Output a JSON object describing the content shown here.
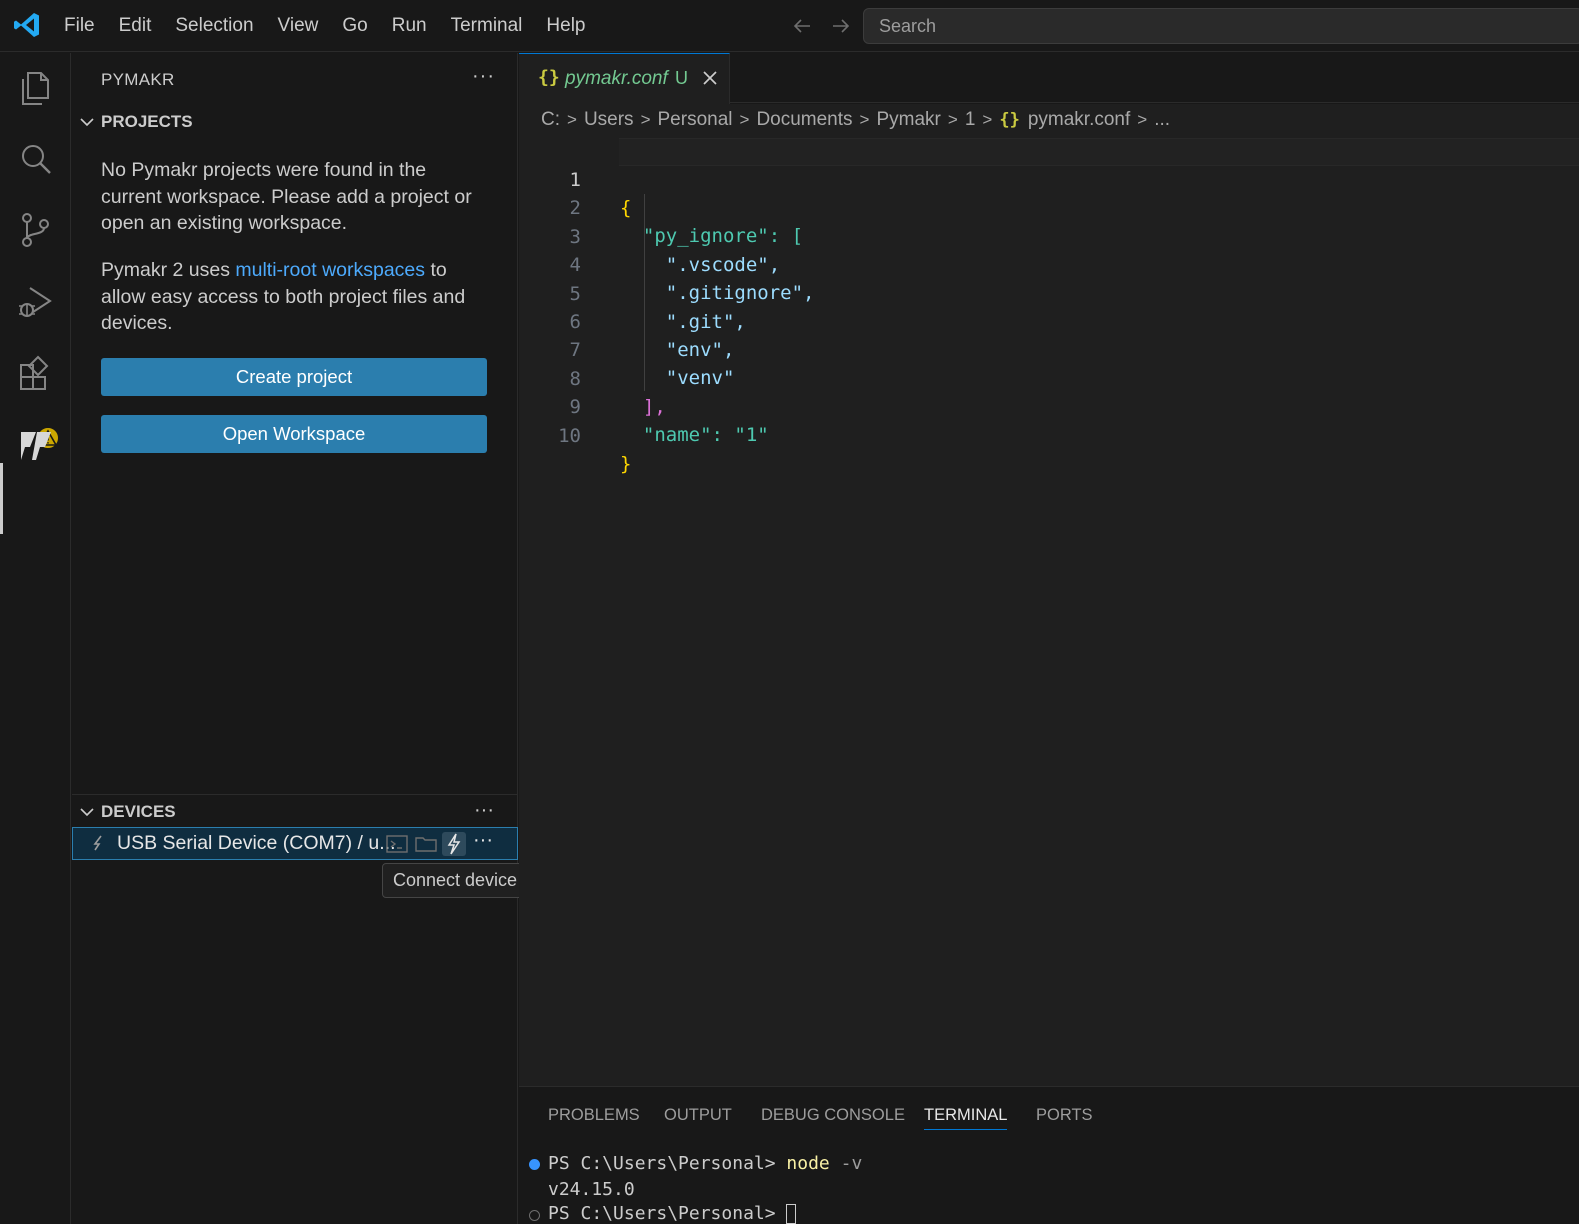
{
  "menu": [
    "File",
    "Edit",
    "Selection",
    "View",
    "Go",
    "Run",
    "Terminal",
    "Help"
  ],
  "search": {
    "placeholder": "Search"
  },
  "sidebar": {
    "title": "PYMAKR",
    "projects": {
      "header": "PROJECTS",
      "message1": "No Pymakr projects were found in the current workspace. Please add a project or open an existing workspace.",
      "message2_prefix": "Pymakr 2 uses ",
      "message2_link": "multi-root workspaces",
      "message2_suffix": " to allow easy access to both project files and devices.",
      "create_button": "Create project",
      "open_button": "Open Workspace"
    },
    "devices": {
      "header": "DEVICES",
      "device_name": "USB Serial Device (COM7) / u...",
      "tooltip": "Connect device"
    }
  },
  "editor": {
    "tab": {
      "filename": "pymakr.conf",
      "status": "U",
      "icon": "{}"
    },
    "breadcrumb": [
      "C:",
      "Users",
      "Personal",
      "Documents",
      "Pymakr",
      "1",
      "pymakr.conf",
      "..."
    ],
    "lines": [
      {
        "n": "1",
        "text": "{"
      },
      {
        "n": "2",
        "text": "  \"py_ignore\": ["
      },
      {
        "n": "3",
        "text": "    \".vscode\","
      },
      {
        "n": "4",
        "text": "    \".gitignore\","
      },
      {
        "n": "5",
        "text": "    \".git\","
      },
      {
        "n": "6",
        "text": "    \"env\","
      },
      {
        "n": "7",
        "text": "    \"venv\""
      },
      {
        "n": "8",
        "text": "  ],"
      },
      {
        "n": "9",
        "text": "  \"name\": \"1\""
      },
      {
        "n": "10",
        "text": "}"
      }
    ]
  },
  "panel": {
    "tabs": [
      "PROBLEMS",
      "OUTPUT",
      "DEBUG CONSOLE",
      "TERMINAL",
      "PORTS"
    ],
    "active_tab": "TERMINAL",
    "terminal": {
      "line1_prompt": "PS C:\\Users\\Personal> ",
      "line1_cmd": "node",
      "line1_arg": " -v",
      "line2": "v24.15.0",
      "line3_prompt": "PS C:\\Users\\Personal> "
    }
  },
  "colors": {
    "accent": "#0078d4",
    "button": "#2b7eae",
    "link": "#4daafc",
    "untracked": "#73c991",
    "warning": "#cca700"
  }
}
